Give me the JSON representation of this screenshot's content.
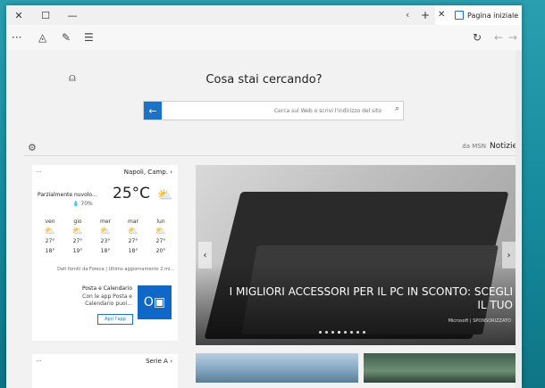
{
  "window": {
    "tab_title": "Pagina iniziale",
    "icons": {
      "close": "close-icon",
      "minimize": "minimize-icon",
      "maximize": "maximize-icon",
      "new_tab": "plus-icon",
      "back": "back-arrow-icon",
      "forward": "forward-arrow-icon",
      "refresh": "refresh-icon",
      "menu": "more-dots-icon",
      "share": "share-icon",
      "note": "note-icon",
      "hub": "hub-icon"
    }
  },
  "glyphs": {
    "close": "✕",
    "maximize": "☐",
    "minimize": "—",
    "newtab": "+",
    "tabprev": "‹",
    "more": "···",
    "share": "◬",
    "note": "✎",
    "hub": "☰",
    "refresh": "↻",
    "back": "←",
    "forward": "→",
    "user": "⍝",
    "search_go": "←",
    "search_icon": "⌕",
    "gear": "⚙",
    "sun_cloud": "⛅",
    "arrow_left": "‹",
    "arrow_right": "›",
    "outlook": "O▣"
  },
  "main": {
    "headline": "Cosa stai cercando?",
    "search_placeholder": "Cerca sul Web o scrivi l'indirizzo del sito",
    "news_label": "Notizie",
    "news_source": "da MSN"
  },
  "weather": {
    "dots": "···",
    "location": "Napoli, Camp. ›",
    "condition": "Parzialmente nuvolo...",
    "humidity": "💧 70%",
    "temperature": "25°C",
    "days": [
      {
        "name": "lun",
        "hi": "27°",
        "lo": "20°"
      },
      {
        "name": "mar",
        "hi": "27°",
        "lo": "18°"
      },
      {
        "name": "mer",
        "hi": "23°",
        "lo": "18°"
      },
      {
        "name": "gio",
        "hi": "27°",
        "lo": "19°"
      },
      {
        "name": "ven",
        "hi": "27°",
        "lo": "18°"
      }
    ],
    "footer": "Dati forniti da Foreca | Ultimo aggiornamento 2 mi..."
  },
  "app_card": {
    "title": "Posta e Calendario",
    "description": "Con le app Posta e Calendario puoi...",
    "button": "Apri l'app"
  },
  "seriea": {
    "dots": "···",
    "label": "Serie A ›"
  },
  "hero": {
    "title": "I MIGLIORI ACCESSORI PER IL PC IN SCONTO: SCEGLI IL TUO",
    "source": "Microsoft | SPONSORIZZATO"
  },
  "colors": {
    "accent": "#1a73c9",
    "mail_tile": "#0f68c8"
  }
}
